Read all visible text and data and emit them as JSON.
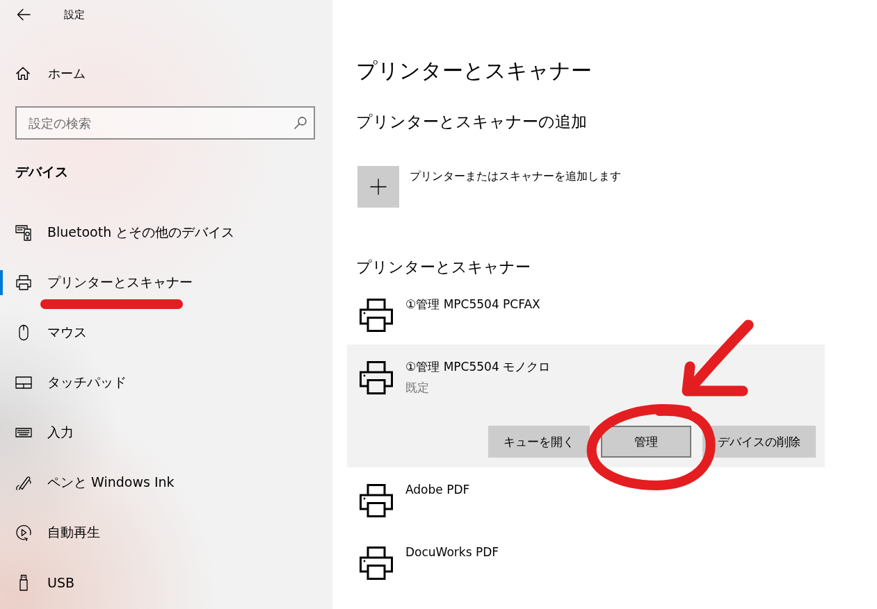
{
  "window": {
    "title": "設定"
  },
  "sidebar": {
    "home": "ホーム",
    "search": {
      "placeholder": "設定の検索"
    },
    "section": "デバイス",
    "items": [
      {
        "label": "Bluetooth とその他のデバイス",
        "kind": "devices",
        "selected": false
      },
      {
        "label": "プリンターとスキャナー",
        "kind": "printer",
        "selected": true
      },
      {
        "label": "マウス",
        "kind": "mouse",
        "selected": false
      },
      {
        "label": "タッチパッド",
        "kind": "touchpad",
        "selected": false
      },
      {
        "label": "入力",
        "kind": "keyboard",
        "selected": false
      },
      {
        "label": "ペンと Windows Ink",
        "kind": "pen",
        "selected": false
      },
      {
        "label": "自動再生",
        "kind": "autoplay",
        "selected": false
      },
      {
        "label": "USB",
        "kind": "usb",
        "selected": false
      }
    ]
  },
  "page": {
    "title": "プリンターとスキャナー",
    "add_heading": "プリンターとスキャナーの追加",
    "add_button": "プリンターまたはスキャナーを追加します",
    "list_heading": "プリンターとスキャナー",
    "printers": [
      {
        "name": "①管理 MPC5504 PCFAX",
        "selected": false
      },
      {
        "name": "①管理 MPC5504 モノクロ",
        "status": "既定",
        "selected": true,
        "actions": [
          {
            "label": "キューを開く",
            "focused": false
          },
          {
            "label": "管理",
            "focused": true
          },
          {
            "label": "デバイスの削除",
            "focused": false
          }
        ]
      },
      {
        "name": "Adobe PDF",
        "selected": false
      },
      {
        "name": "DocuWorks PDF",
        "selected": false
      }
    ]
  },
  "annotations": [
    {
      "kind": "underline"
    },
    {
      "kind": "arrow"
    },
    {
      "kind": "circle"
    }
  ]
}
